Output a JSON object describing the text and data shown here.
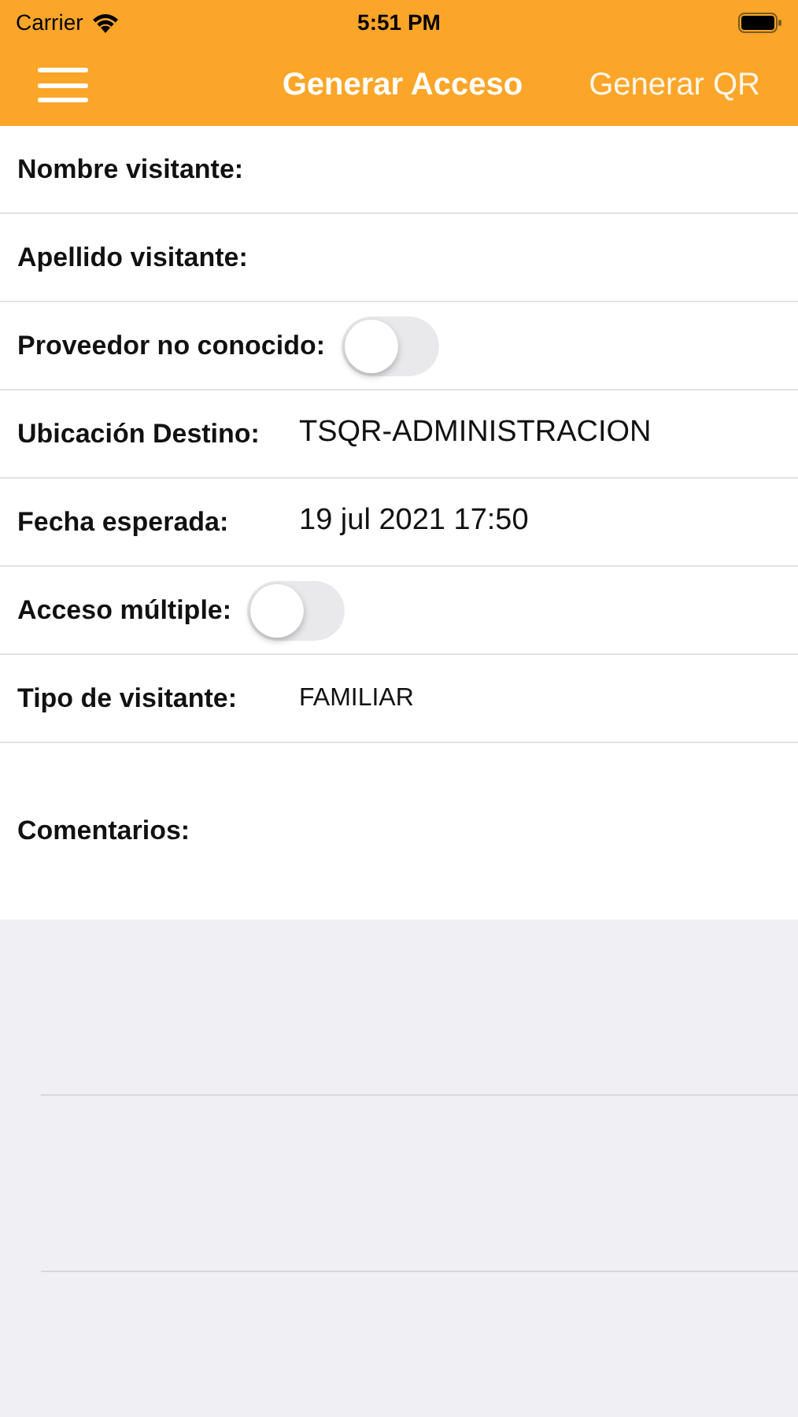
{
  "status_bar": {
    "carrier": "Carrier",
    "time": "5:51 PM"
  },
  "nav": {
    "tabs": [
      {
        "label": "Generar Acceso",
        "selected": true
      },
      {
        "label": "Generar QR",
        "selected": false
      }
    ]
  },
  "form": {
    "rows": [
      {
        "kind": "text",
        "label": "Nombre visitante:"
      },
      {
        "kind": "text",
        "label": "Apellido visitante:"
      },
      {
        "kind": "toggle",
        "label": "Proveedor no conocido:",
        "on": false
      },
      {
        "kind": "value",
        "label": "Ubicación Destino:",
        "value": "TSQR-ADMINISTRACION"
      },
      {
        "kind": "value",
        "label": "Fecha esperada:",
        "value": "19 jul 2021 17:50"
      },
      {
        "kind": "toggle",
        "label": "Acceso múltiple:",
        "on": false
      },
      {
        "kind": "value_small",
        "label": "Tipo de visitante:",
        "value": "FAMILIAR"
      },
      {
        "kind": "comment",
        "label": "Comentarios:"
      }
    ]
  }
}
